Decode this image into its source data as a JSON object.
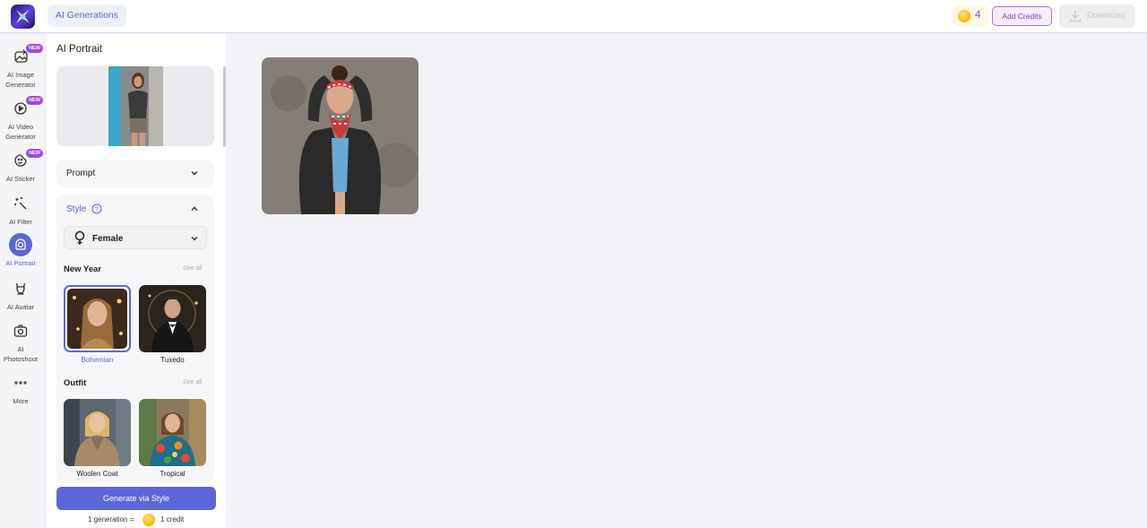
{
  "header": {
    "tab_label": "AI Generations",
    "credit_count": "4",
    "add_credits_label": "Add Credits",
    "download_label": "Download"
  },
  "nav": {
    "items": [
      {
        "label": "AI Image Generator",
        "badge": "NEW",
        "icon": "image-generator-icon"
      },
      {
        "label": "AI Video Generator",
        "badge": "NEW",
        "icon": "video-generator-icon"
      },
      {
        "label": "AI Sticker",
        "badge": "NEW",
        "icon": "sticker-icon"
      },
      {
        "label": "AI Filter",
        "icon": "magic-wand-icon"
      },
      {
        "label": "AI Portrait",
        "icon": "portrait-icon",
        "active": true
      },
      {
        "label": "AI Avatar",
        "icon": "avatar-icon"
      },
      {
        "label": "AI Photoshoot",
        "icon": "camera-icon"
      },
      {
        "label": "More",
        "icon": "more-dots-icon"
      }
    ]
  },
  "panel": {
    "title": "AI Portrait",
    "prompt_label": "Prompt",
    "style_label": "Style",
    "gender_value": "Female",
    "sections": [
      {
        "title": "New Year",
        "see_all": "See all",
        "styles": [
          {
            "label": "Bohemian",
            "selected": true
          },
          {
            "label": "Tuxedo",
            "selected": false
          }
        ]
      },
      {
        "title": "Outfit",
        "see_all": "See all",
        "styles": [
          {
            "label": "Woolen Coat",
            "selected": false
          },
          {
            "label": "Tropical",
            "selected": false
          }
        ]
      }
    ],
    "generate_label": "Generate via Style",
    "note_left": "1 generation =",
    "note_right": "1 credit"
  },
  "colors": {
    "accent": "#5b66d6",
    "brand_purple": "#7a3fc0",
    "background": "#f2f2f7"
  }
}
